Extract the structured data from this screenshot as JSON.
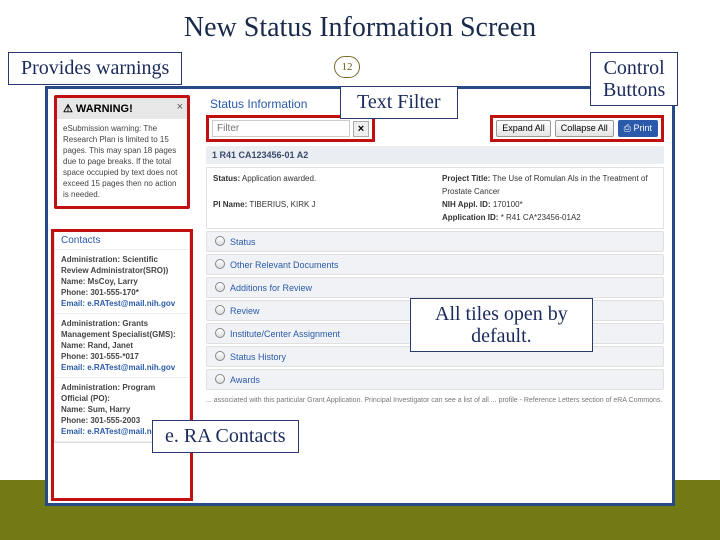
{
  "slide": {
    "title": "New Status Information Screen",
    "page_number": "12",
    "callouts": {
      "warnings": "Provides warnings",
      "text_filter": "Text Filter",
      "control_buttons": "Control\nButtons",
      "tiles_default": "All tiles open by\ndefault.",
      "era_contacts": "e. RA Contacts"
    }
  },
  "frame": {
    "status_info_heading": "Status Information",
    "warning": {
      "header": "⚠ WARNING!",
      "close": "×",
      "body": "eSubmission warning: The Research Plan is limited to 15 pages. This may span 18 pages due to page breaks. If the total space occupied by text does not exceed 15 pages then no action is needed."
    },
    "contacts": {
      "heading": "Contacts",
      "blocks": [
        {
          "role": "Administration: Scientific Review Administrator(SRO))",
          "name": "Name: MsCoy, Larry",
          "phone": "Phone: 301-555-170*",
          "email": "Email: e.RATest@mail.nih.gov"
        },
        {
          "role": "Administration: Grants Management Specialist(GMS):",
          "name": "Name: Rand, Janet",
          "phone": "Phone: 301-555-*017",
          "email": "Email: e.RATest@mail.nih.gov"
        },
        {
          "role": "Administration: Program Official (PO):",
          "name": "Name: Sum, Harry",
          "phone": "Phone: 301-555-2003",
          "email": "Email: e.RATest@mail.nih.gov"
        }
      ]
    },
    "filter": {
      "placeholder": "Filter",
      "clear": "×"
    },
    "buttons": {
      "expand": "Expand All",
      "collapse": "Collapse All",
      "print": "⎙ Print"
    },
    "app_bar": "1 R41 CA123456-01 A2",
    "summary": {
      "status_lab": "Status:",
      "status_val": "Application awarded.",
      "title_lab": "Project Title:",
      "title_val": "The Use of Romulan Als in the Treatment of Prostate Cancer",
      "pi_lab": "PI Name:",
      "pi_val": "TIBERIUS, KIRK J",
      "nihid_lab": "NIH Appl. ID:",
      "nihid_val": "170100*",
      "appid_lab": "Application ID:",
      "appid_val": "* R41 CA*23456-01A2"
    },
    "tiles": [
      "Status",
      "Other Relevant Documents",
      "Additions for Review",
      "Review",
      "Institute/Center Assignment",
      "Status History",
      "Awards"
    ],
    "disclaimer": "... associated with this particular Grant Application. Principal Investigator can see a list of all ... profile - Reference Letters section of eRA Commons."
  }
}
